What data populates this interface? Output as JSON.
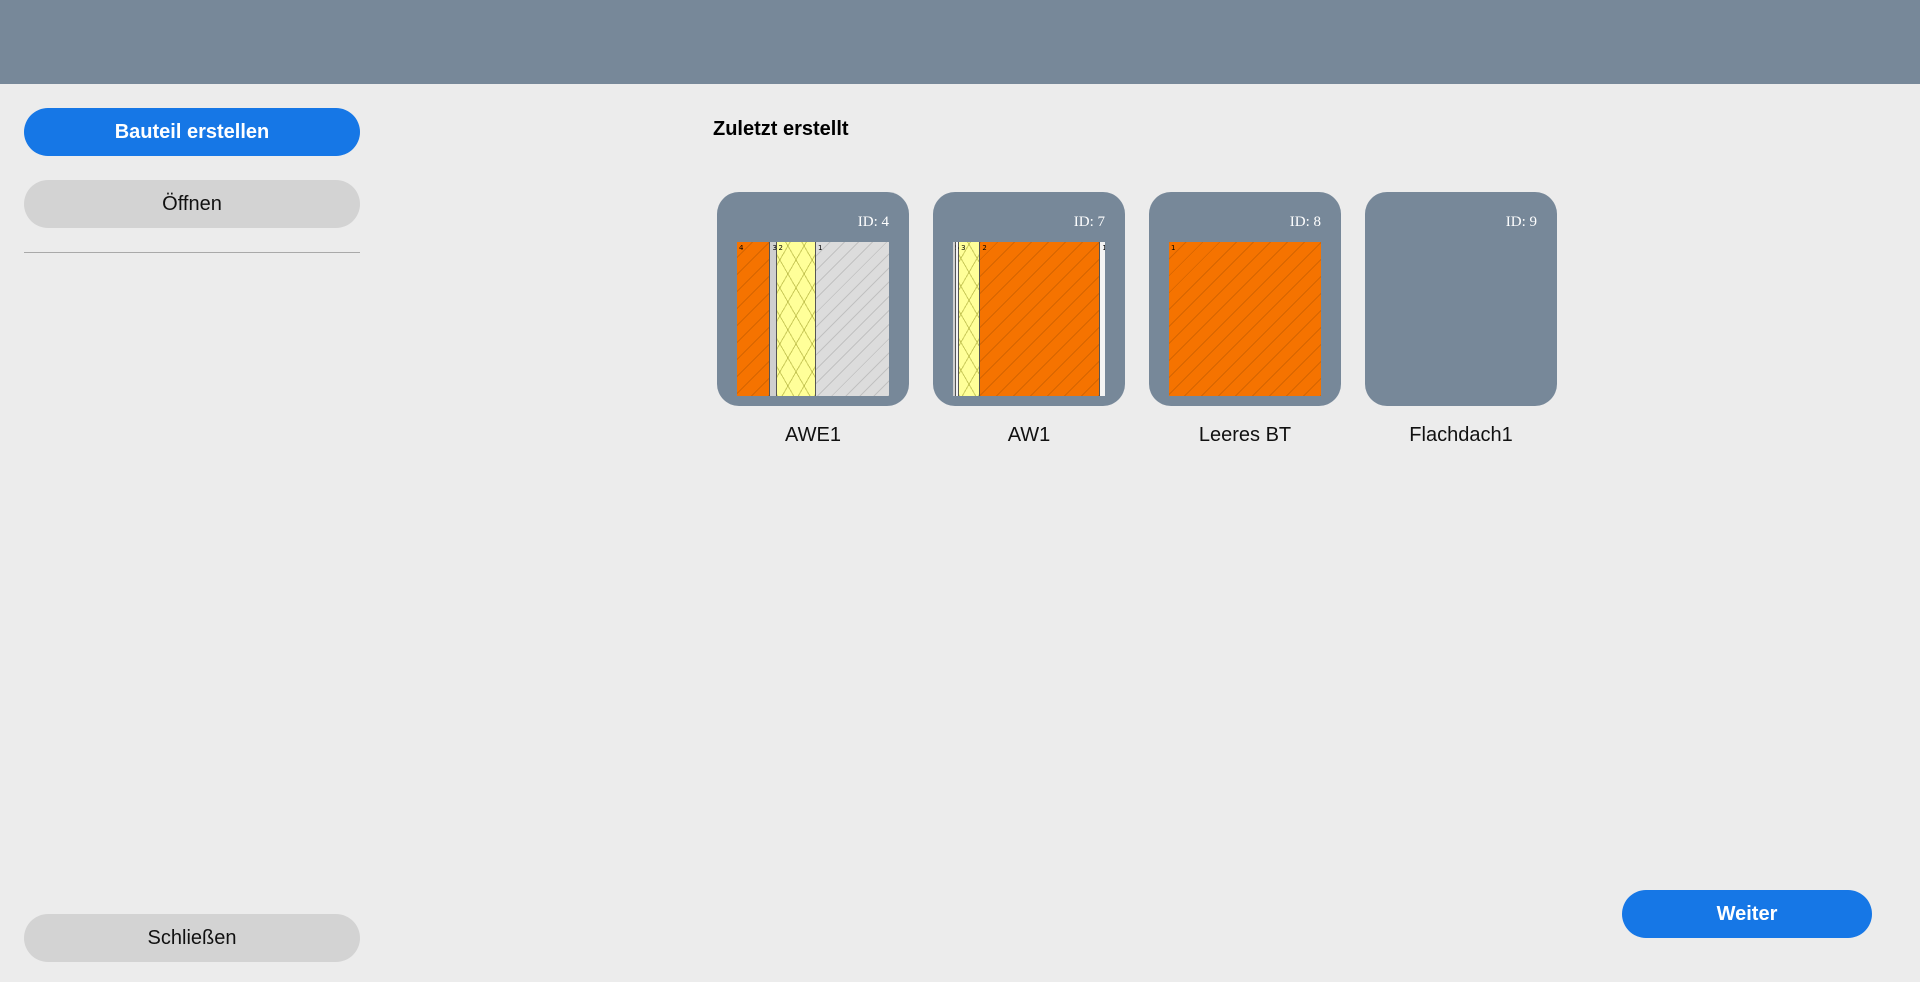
{
  "sidebar": {
    "create_label": "Bauteil erstellen",
    "open_label": "Öffnen",
    "close_label": "Schließen"
  },
  "main": {
    "section_title": "Zuletzt erstellt",
    "next_label": "Weiter",
    "cards": [
      {
        "id_text": "ID: 4",
        "name": "AWE1",
        "layers": [
          {
            "num": "4",
            "material": "orange",
            "share": 22
          },
          {
            "num": "3",
            "material": "lightgray",
            "share": 4
          },
          {
            "num": "2",
            "material": "yellow",
            "share": 26
          },
          {
            "num": "1",
            "material": "gray",
            "share": 48
          }
        ]
      },
      {
        "id_text": "ID: 7",
        "name": "AW1",
        "layers": [
          {
            "num": "5",
            "material": "lightgray",
            "share": 2
          },
          {
            "num": "4",
            "material": "white",
            "share": 2
          },
          {
            "num": "3",
            "material": "yellow",
            "share": 14
          },
          {
            "num": "2",
            "material": "orange",
            "share": 79
          },
          {
            "num": "1",
            "material": "white",
            "share": 3
          }
        ]
      },
      {
        "id_text": "ID: 8",
        "name": "Leeres BT",
        "layers": [
          {
            "num": "1",
            "material": "orange",
            "share": 100
          }
        ]
      },
      {
        "id_text": "ID: 9",
        "name": "Flachdach1",
        "layers": []
      }
    ]
  },
  "colors": {
    "topbar": "#778899",
    "background": "#ececec",
    "primary_button": "#1677e6",
    "secondary_button": "#d3d3d3",
    "card": "#778899",
    "orange_material": "#f57300",
    "yellow_material": "#ffff99"
  }
}
